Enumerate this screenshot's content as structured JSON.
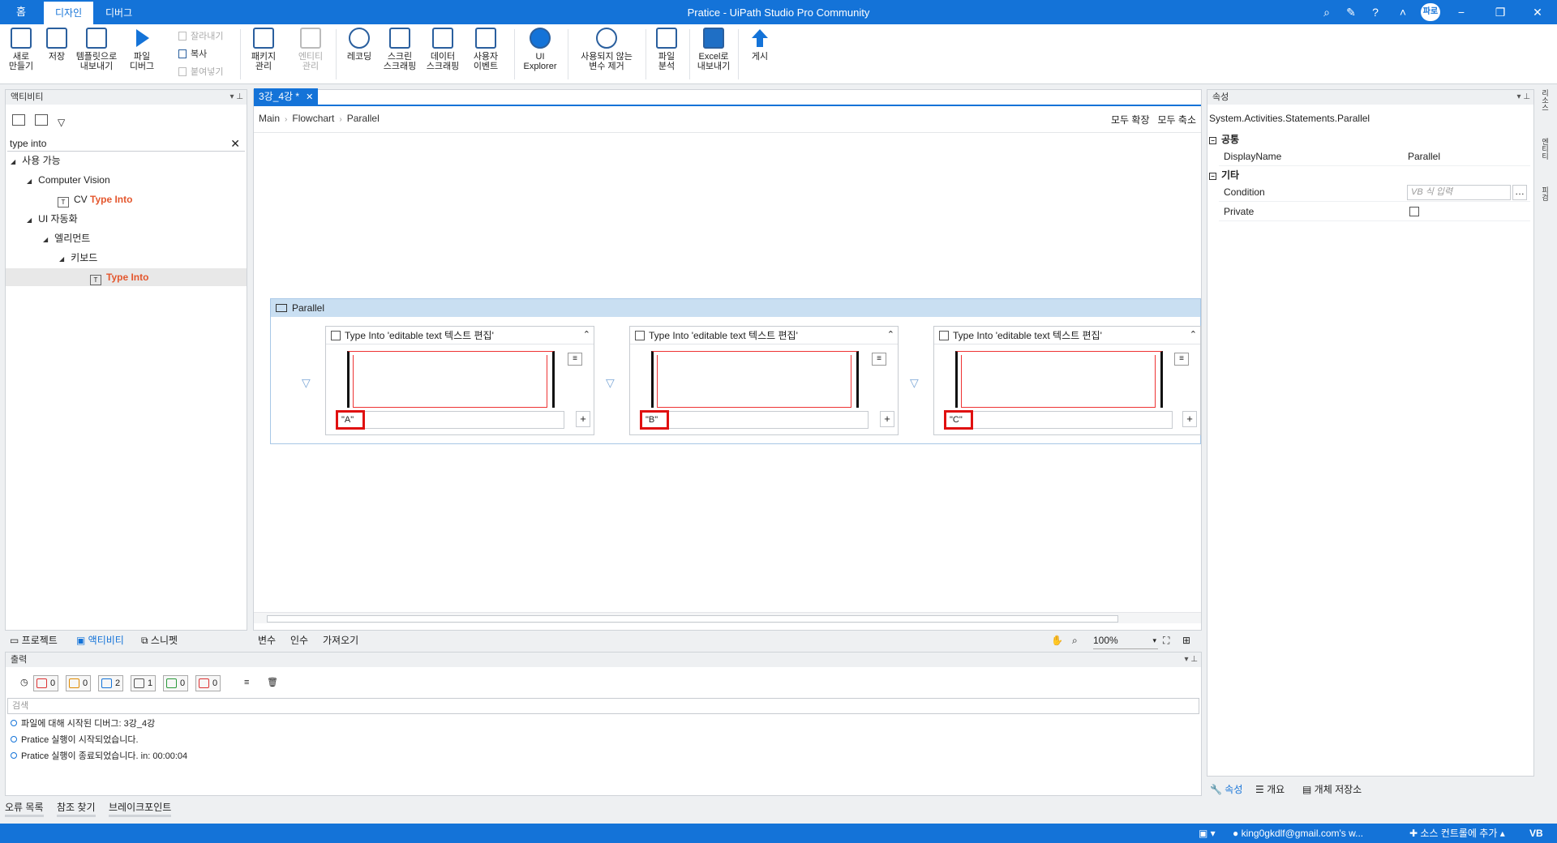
{
  "window": {
    "title": "Pratice - UiPath Studio Pro Community",
    "home_label": "홈",
    "tabs": [
      "디자인",
      "디버그"
    ],
    "user_initials": "파로"
  },
  "ribbon": {
    "new_label": "새로\n만들기",
    "save_label": "저장",
    "template_export_label": "템플릿으로\n내보내기",
    "debug_file_label": "파일\n디버그",
    "cut_label": "잘라내기",
    "copy_label": "복사",
    "paste_label": "붙여넣기",
    "packages_label": "패키지\n관리",
    "entities_label": "엔티티\n관리",
    "recording_label": "레코딩",
    "screen_scraping_label": "스크린\n스크래핑",
    "data_scraping_label": "데이터\n스크래핑",
    "user_events_label": "사용자\n이벤트",
    "ui_explorer_label": "UI\nExplorer",
    "remove_unused_label": "사용되지 않는\n변수 제거",
    "file_analysis_label": "파일\n분석",
    "export_excel_label": "Excel로\n내보내기",
    "publish_label": "게시"
  },
  "activities": {
    "header": "액티비티",
    "search_value": "type into",
    "tree": {
      "available": "사용 가능",
      "computer_vision": "Computer Vision",
      "cv_prefix": "CV",
      "cv_match": "Type Into",
      "ui_automation": "UI 자동화",
      "element": "엘리먼트",
      "keyboard": "키보드",
      "type_into": "Type Into"
    },
    "bottom_tabs": [
      "프로젝트",
      "액티비티",
      "스니펫"
    ]
  },
  "designer": {
    "doc_tab": "3강_4강 *",
    "breadcrumb": [
      "Main",
      "Flowchart",
      "Parallel"
    ],
    "expand_all": "모두 확장",
    "collapse_all": "모두 축소",
    "parallel_label": "Parallel",
    "activities": [
      {
        "title": "Type Into 'editable text  텍스트 편집'",
        "value": "\"A\""
      },
      {
        "title": "Type Into 'editable text  텍스트 편집'",
        "value": "\"B\""
      },
      {
        "title": "Type Into 'editable text  텍스트 편집'",
        "value": "\"C\""
      }
    ],
    "bottom_tabs": [
      "변수",
      "인수",
      "가져오기"
    ],
    "zoom": "100%"
  },
  "properties": {
    "header": "속성",
    "type_path": "System.Activities.Statements.Parallel",
    "group_common": "공통",
    "group_misc": "기타",
    "display_name_label": "DisplayName",
    "display_name_value": "Parallel",
    "condition_label": "Condition",
    "condition_placeholder": "VB 식 입력",
    "private_label": "Private",
    "bottom_tabs": [
      "속성",
      "개요",
      "개체 저장소"
    ],
    "side_strip": [
      "리소스",
      "엔티티",
      "피검"
    ]
  },
  "output": {
    "header": "출력",
    "counts": {
      "error": "0",
      "warning": "0",
      "info": "2",
      "trace": "1",
      "verbose": "0",
      "critical": "0"
    },
    "search_placeholder": "검색",
    "lines": [
      "파일에 대해 시작된 디버그: 3강_4강",
      "Pratice 실행이 시작되었습니다.",
      "Pratice 실행이 종료되었습니다. in: 00:00:04"
    ],
    "bottom_tabs": [
      "오류 목록",
      "참조 찾기",
      "브레이크포인트"
    ]
  },
  "status": {
    "account": "king0gkdlf@gmail.com's w...",
    "source_control": "소스 컨트롤에 추가",
    "language": "VB"
  },
  "colors": {
    "accent": "#1473d8",
    "highlight": "#e4572e",
    "value_border": "#e01010"
  }
}
